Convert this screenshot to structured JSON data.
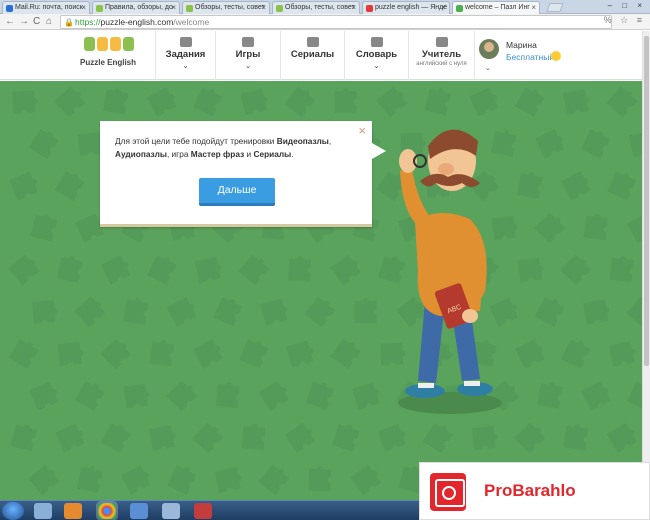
{
  "browser": {
    "tabs": [
      {
        "label": "Mail.Ru: почта, поиск",
        "fav": "#2a6fd6"
      },
      {
        "label": "Правила, обзоры, до",
        "fav": "#8bc34a"
      },
      {
        "label": "Обзоры, тесты, совет",
        "fav": "#8bc34a"
      },
      {
        "label": "Обзоры, тесты, совет",
        "fav": "#8bc34a"
      },
      {
        "label": "puzzle english — Янде",
        "fav": "#e53935"
      },
      {
        "label": "welcome – Пазл Инг",
        "fav": "#4caf50"
      }
    ],
    "url_scheme": "https://",
    "url_host": "puzzle-english.com",
    "url_path": "/welcome"
  },
  "header": {
    "logo_text": "Puzzle English",
    "nav": [
      {
        "label": "Задания"
      },
      {
        "label": "Игры"
      },
      {
        "label": "Сериалы"
      },
      {
        "label": "Словарь"
      },
      {
        "label": "Учитель",
        "sub": "английский с нуля"
      }
    ],
    "user": {
      "name": "Марина",
      "plan": "Бесплатный"
    }
  },
  "dialog": {
    "text_1": "Для этой цели тебе подойдут тренировки ",
    "bold_1": "Видеопазлы",
    "text_2": ", ",
    "bold_2": "Аудиопазлы",
    "text_3": ", игра ",
    "bold_3": "Мастер фраз",
    "text_4": " и ",
    "bold_4": "Сериалы",
    "text_5": ".",
    "button": "Дальше",
    "close_glyph": "×"
  },
  "illustration": {
    "book_label": "ABC"
  },
  "watermark": {
    "text": "ProBarahlo"
  },
  "colors": {
    "accent": "#3b9de1",
    "background": "#5aa35c",
    "brand_red": "#e3262b"
  }
}
